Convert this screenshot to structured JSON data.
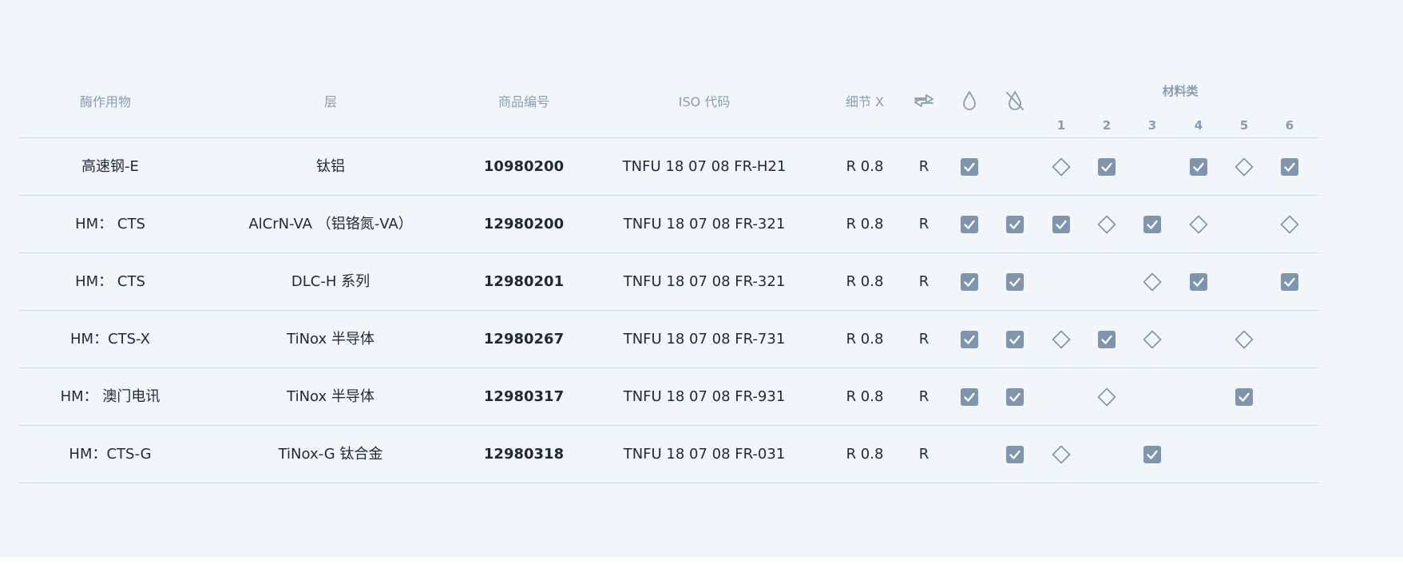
{
  "colors": {
    "background": "#f2f6fa",
    "header_text": "#8b9db1",
    "body_text": "#1f2a36",
    "check_fill": "#7f95ad",
    "divider": "#d3dbe4"
  },
  "header": {
    "col_workpiece": "酶作用物",
    "col_layer": "层",
    "col_article": "商品编号",
    "col_iso": "ISO 代码",
    "col_detail": "细节 X",
    "icon_direction": "swap-arrows-icon",
    "icon_coolant": "water-drop-icon",
    "icon_no_coolant": "no-water-drop-icon",
    "material_class_title": "材料类",
    "material_classes": [
      "1",
      "2",
      "3",
      "4",
      "5",
      "6"
    ]
  },
  "rows": [
    {
      "workpiece": "高速钢-E",
      "layer": "钛铝",
      "article": "10980200",
      "iso": "TNFU 18 07 08 FR-H21",
      "detail": "R 0.8",
      "direction": "R",
      "coolant": "check",
      "no_coolant": "none",
      "classes": [
        "diamond",
        "check",
        "none",
        "check",
        "diamond",
        "check"
      ]
    },
    {
      "workpiece": "HM： CTS",
      "layer": "AlCrN-VA （铝铬氮-VA）",
      "article": "12980200",
      "iso": "TNFU 18 07 08 FR-321",
      "detail": "R 0.8",
      "direction": "R",
      "coolant": "check",
      "no_coolant": "check",
      "classes": [
        "check",
        "diamond",
        "check",
        "diamond",
        "none",
        "diamond"
      ]
    },
    {
      "workpiece": "HM： CTS",
      "layer": "DLC-H 系列",
      "article": "12980201",
      "iso": "TNFU 18 07 08 FR-321",
      "detail": "R 0.8",
      "direction": "R",
      "coolant": "check",
      "no_coolant": "check",
      "classes": [
        "none",
        "none",
        "diamond",
        "check",
        "none",
        "check"
      ]
    },
    {
      "workpiece": "HM：CTS-X",
      "layer": "TiNox 半导体",
      "article": "12980267",
      "iso": "TNFU 18 07 08 FR-731",
      "detail": "R 0.8",
      "direction": "R",
      "coolant": "check",
      "no_coolant": "check",
      "classes": [
        "diamond",
        "check",
        "diamond",
        "none",
        "diamond",
        "none"
      ]
    },
    {
      "workpiece": "HM： 澳门电讯",
      "layer": "TiNox 半导体",
      "article": "12980317",
      "iso": "TNFU 18 07 08 FR-931",
      "detail": "R 0.8",
      "direction": "R",
      "coolant": "check",
      "no_coolant": "check",
      "classes": [
        "none",
        "diamond",
        "none",
        "none",
        "check",
        "none"
      ]
    },
    {
      "workpiece": "HM：CTS-G",
      "layer": "TiNox-G 钛合金",
      "article": "12980318",
      "iso": "TNFU 18 07 08 FR-031",
      "detail": "R 0.8",
      "direction": "R",
      "coolant": "none",
      "no_coolant": "check",
      "classes": [
        "diamond",
        "none",
        "check",
        "none",
        "none",
        "none"
      ]
    }
  ]
}
